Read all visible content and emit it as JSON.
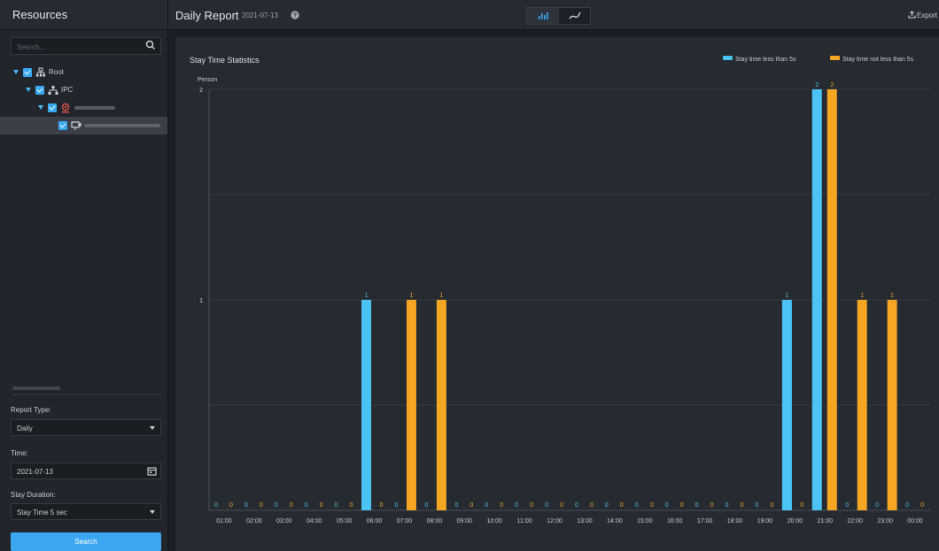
{
  "sidebar": {
    "title": "Resources",
    "search_placeholder": "Search...",
    "tree": [
      {
        "label": "Root",
        "icon": "organization-icon"
      },
      {
        "label": "IPC",
        "icon": "device-group-icon"
      },
      {
        "label": "",
        "icon": "camera-device-icon"
      },
      {
        "label": "",
        "icon": "channel-icon"
      }
    ],
    "report_type_label": "Report Type:",
    "report_type_value": "Daily",
    "time_label": "Time:",
    "time_value": "2021-07-13",
    "stay_duration_label": "Stay Duration:",
    "stay_duration_value": "Stay Time 5 sec",
    "search_button": "Search"
  },
  "header": {
    "title": "Daily Report",
    "date": "2021-07-13",
    "export_label": "Export",
    "views": [
      {
        "name": "bar-chart-icon",
        "active": true
      },
      {
        "name": "line-chart-icon",
        "active": false
      }
    ]
  },
  "colors": {
    "series_a": "#4cc3f5",
    "series_b": "#f5a623",
    "accent": "#3aa7f0"
  },
  "chart_data": {
    "type": "bar",
    "title": "Stay Time Statistics",
    "ylabel": "Person",
    "xlabel": "",
    "ylim": [
      0,
      2
    ],
    "yticks": [
      1,
      2
    ],
    "grid": true,
    "legend_position": "top-right",
    "categories": [
      "01:00",
      "02:00",
      "03:00",
      "04:00",
      "05:00",
      "06:00",
      "07:00",
      "08:00",
      "09:00",
      "10:00",
      "11:00",
      "12:00",
      "13:00",
      "14:00",
      "15:00",
      "16:00",
      "17:00",
      "18:00",
      "19:00",
      "20:00",
      "21:00",
      "22:00",
      "23:00",
      "00:00"
    ],
    "series": [
      {
        "name": "Stay time less than 5s",
        "values": [
          0,
          0,
          0,
          0,
          0,
          1,
          0,
          0,
          0,
          0,
          0,
          0,
          0,
          0,
          0,
          0,
          0,
          0,
          0,
          1,
          2,
          0,
          0,
          0
        ]
      },
      {
        "name": "Stay time not less than 5s",
        "values": [
          0,
          0,
          0,
          0,
          0,
          0,
          1,
          1,
          0,
          0,
          0,
          0,
          0,
          0,
          0,
          0,
          0,
          0,
          0,
          0,
          2,
          1,
          1,
          0
        ]
      }
    ]
  }
}
